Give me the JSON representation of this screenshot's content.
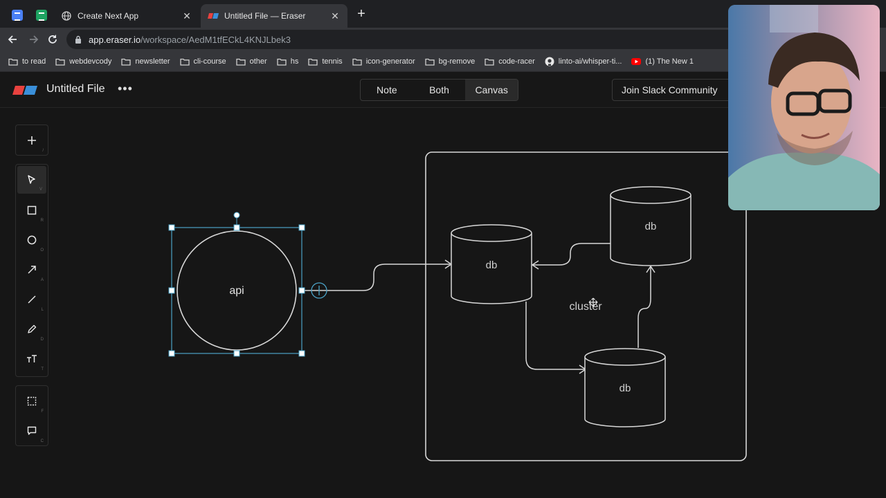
{
  "browser": {
    "tabs": [
      {
        "title": "Create Next App",
        "active": false,
        "favicon": "globe-icon"
      },
      {
        "title": "Untitled File — Eraser",
        "active": true,
        "favicon": "eraser-logo-icon"
      }
    ],
    "url": {
      "host": "app.eraser.io",
      "path": "/workspace/AedM1tfECkL4KNJLbek3"
    },
    "bookmarks": [
      {
        "label": "to read",
        "icon": "folder-icon"
      },
      {
        "label": "webdevcody",
        "icon": "folder-icon"
      },
      {
        "label": "newsletter",
        "icon": "folder-icon"
      },
      {
        "label": "cli-course",
        "icon": "folder-icon"
      },
      {
        "label": "other",
        "icon": "folder-icon"
      },
      {
        "label": "hs",
        "icon": "folder-icon"
      },
      {
        "label": "tennis",
        "icon": "folder-icon"
      },
      {
        "label": "icon-generator",
        "icon": "folder-icon"
      },
      {
        "label": "bg-remove",
        "icon": "folder-icon"
      },
      {
        "label": "code-racer",
        "icon": "folder-icon"
      },
      {
        "label": "linto-ai/whisper-ti...",
        "icon": "github-icon"
      },
      {
        "label": "(1) The New 1",
        "icon": "youtube-icon"
      }
    ]
  },
  "app": {
    "file_title": "Untitled File",
    "view_modes": [
      "Note",
      "Both",
      "Canvas"
    ],
    "selected_view": "Canvas",
    "join_slack_label": "Join Slack Community",
    "tools": [
      {
        "name": "add",
        "hint": "/"
      },
      {
        "name": "select",
        "hint": "V",
        "selected": true
      },
      {
        "name": "rectangle",
        "hint": "R"
      },
      {
        "name": "ellipse",
        "hint": "O"
      },
      {
        "name": "arrow",
        "hint": "A"
      },
      {
        "name": "line",
        "hint": "L"
      },
      {
        "name": "pencil",
        "hint": "D"
      },
      {
        "name": "text",
        "hint": "T"
      },
      {
        "name": "frame",
        "hint": "F"
      },
      {
        "name": "comment",
        "hint": "C"
      }
    ]
  },
  "canvas": {
    "api_label": "api",
    "cluster_label": "cluster",
    "db_labels": [
      "db",
      "db",
      "db"
    ]
  },
  "colors": {
    "selection": "#4ba3c7",
    "stroke": "#d8d8d8",
    "canvas_bg": "#161616"
  }
}
